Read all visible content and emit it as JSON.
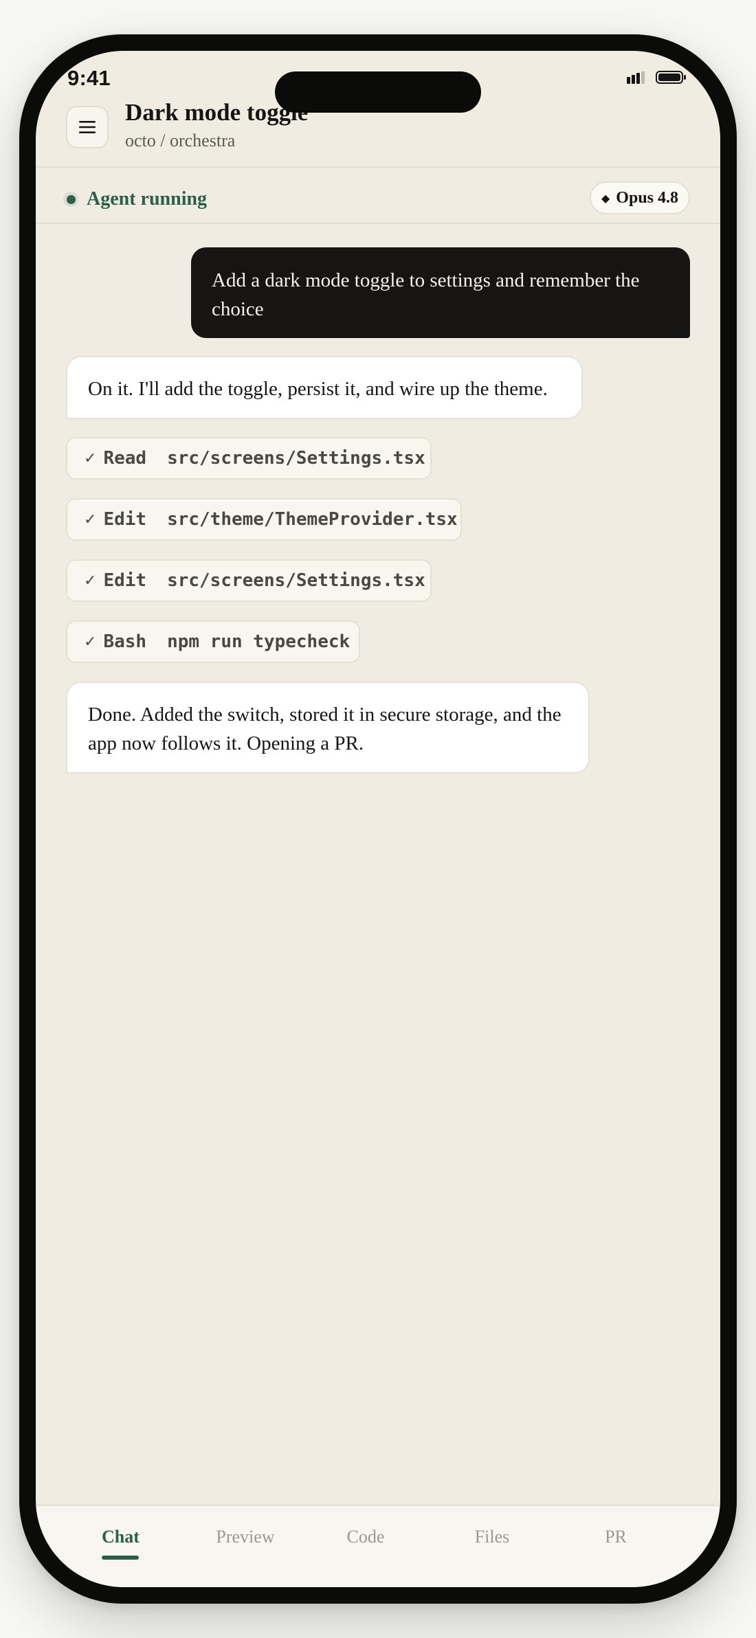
{
  "status_bar": {
    "time": "9:41"
  },
  "header": {
    "title": "Dark mode toggle",
    "repo": "octo / orchestra",
    "menu_icon": "hamburger-menu-icon"
  },
  "agent": {
    "status": "Agent running",
    "status_color": "#2d5e48",
    "model": "Opus 4.8",
    "model_icon": "diamond-icon"
  },
  "chat": {
    "user_message": "Add a dark mode toggle to settings and remember the choice",
    "assistant_intro": "On it. I'll add the toggle, persist it, and wire up the theme.",
    "tool_calls": [
      {
        "tool": "Read",
        "arg": "src/screens/Settings.tsx",
        "status": "done"
      },
      {
        "tool": "Edit",
        "arg": "src/theme/ThemeProvider.tsx",
        "status": "done"
      },
      {
        "tool": "Edit",
        "arg": "src/screens/Settings.tsx",
        "status": "done"
      },
      {
        "tool": "Bash",
        "arg": "npm run typecheck",
        "status": "done"
      }
    ],
    "assistant_done": "Done. Added the switch, stored it in secure storage, and the app now follows it. Opening a PR."
  },
  "tabs": [
    {
      "label": "Chat",
      "active": true
    },
    {
      "label": "Preview",
      "active": false
    },
    {
      "label": "Code",
      "active": false
    },
    {
      "label": "Files",
      "active": false
    },
    {
      "label": "PR",
      "active": false
    }
  ],
  "colors": {
    "background": "#f0ece2",
    "accent": "#2d5e48",
    "user_bubble": "#161513"
  }
}
